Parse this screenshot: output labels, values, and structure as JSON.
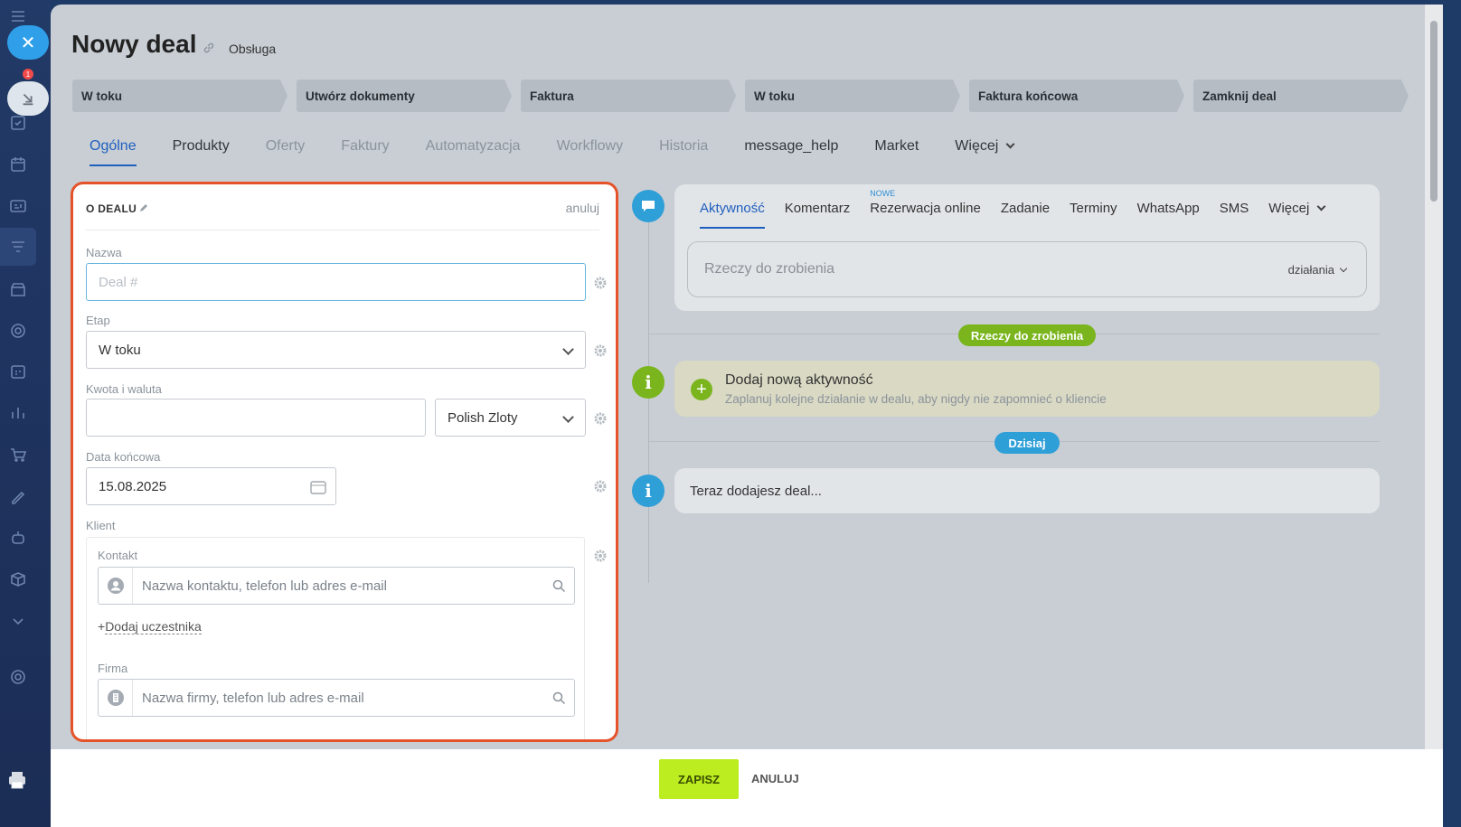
{
  "sidebar": {
    "badge": "1",
    "top_label": "NOWE"
  },
  "header": {
    "title": "Nowy deal",
    "subtitle": "Obsługa"
  },
  "stages": [
    {
      "label": "W toku"
    },
    {
      "label": "Utwórz dokumenty"
    },
    {
      "label": "Faktura"
    },
    {
      "label": "W toku"
    },
    {
      "label": "Faktura końcowa"
    },
    {
      "label": "Zamknij deal"
    }
  ],
  "tabs": [
    {
      "label": "Ogólne",
      "style": "active"
    },
    {
      "label": "Produkty",
      "style": "dark"
    },
    {
      "label": "Oferty",
      "style": "muted"
    },
    {
      "label": "Faktury",
      "style": "muted"
    },
    {
      "label": "Automatyzacja",
      "style": "muted"
    },
    {
      "label": "Workflowy",
      "style": "muted"
    },
    {
      "label": "Historia",
      "style": "muted"
    },
    {
      "label": "message_help",
      "style": "dark"
    },
    {
      "label": "Market",
      "style": "dark"
    },
    {
      "label": "Więcej",
      "style": "dark"
    }
  ],
  "form": {
    "section_title": "O DEALU",
    "cancel_label": "anuluj",
    "name_label": "Nazwa",
    "name_placeholder": "Deal #",
    "stage_label": "Etap",
    "stage_value": "W toku",
    "amount_label": "Kwota i waluta",
    "amount_value": "",
    "currency_value": "Polish Zloty",
    "end_date_label": "Data końcowa",
    "end_date_value": "15.08.2025",
    "client_label": "Klient",
    "contact_label": "Kontakt",
    "contact_placeholder": "Nazwa kontaktu, telefon lub adres e-mail",
    "add_participant": "Dodaj uczestnika",
    "company_label": "Firma",
    "company_placeholder": "Nazwa firmy, telefon lub adres e-mail"
  },
  "activity": {
    "tabs": [
      {
        "label": "Aktywność"
      },
      {
        "label": "Komentarz"
      },
      {
        "label": "Rezerwacja online",
        "tag": "NOWE"
      },
      {
        "label": "Zadanie"
      },
      {
        "label": "Terminy"
      },
      {
        "label": "WhatsApp"
      },
      {
        "label": "SMS"
      },
      {
        "label": "Więcej"
      }
    ],
    "todo_placeholder": "Rzeczy do zrobienia",
    "todo_actions": "działania",
    "todo_pill": "Rzeczy do zrobienia",
    "add_title": "Dodaj nową aktywność",
    "add_desc": "Zaplanuj kolejne działanie w dealu, aby nigdy nie zapomnieć o kliencie",
    "today_pill": "Dzisiaj",
    "adding_text": "Teraz dodajesz deal..."
  },
  "footer": {
    "save_label": "ZAPISZ",
    "cancel_label": "ANULUJ"
  },
  "colors": {
    "highlight_border": "#e4532a",
    "accent_blue": "#1f5fbf",
    "save_green": "#bbed21",
    "todo_pill_green": "#7ab51d",
    "today_pill_blue": "#2f9fd8"
  }
}
